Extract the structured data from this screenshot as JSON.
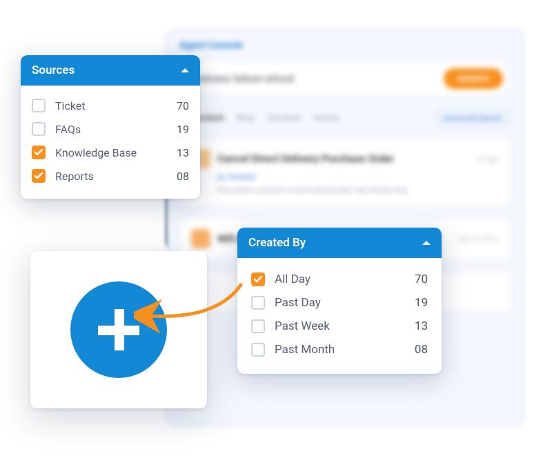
{
  "background": {
    "title": "Agent Console",
    "search_query": "Delivery failure refund",
    "search_button": "SEARCH",
    "tabs": {
      "active": "All Content",
      "t2": "Blog",
      "t3": "Zendesk",
      "t4": "Article",
      "advanced": "Advanced Search"
    },
    "card1": {
      "title": "Cancel Direct Delivery Purchase Order",
      "date": "1d ago"
    },
    "card2": {
      "title": "Will deliveries be affected if change",
      "date": "Jan 30 2021"
    }
  },
  "sources": {
    "title": "Sources",
    "items": [
      {
        "label": "Ticket",
        "count": "70",
        "checked": false
      },
      {
        "label": "FAQs",
        "count": "19",
        "checked": false
      },
      {
        "label": "Knowledge Base",
        "count": "13",
        "checked": true
      },
      {
        "label": "Reports",
        "count": "08",
        "checked": true
      }
    ]
  },
  "created_by": {
    "title": "Created By",
    "items": [
      {
        "label": "All Day",
        "count": "70",
        "checked": true
      },
      {
        "label": "Past Day",
        "count": "19",
        "checked": false
      },
      {
        "label": "Past Week",
        "count": "13",
        "checked": false
      },
      {
        "label": "Past Month",
        "count": "08",
        "checked": false
      }
    ]
  }
}
